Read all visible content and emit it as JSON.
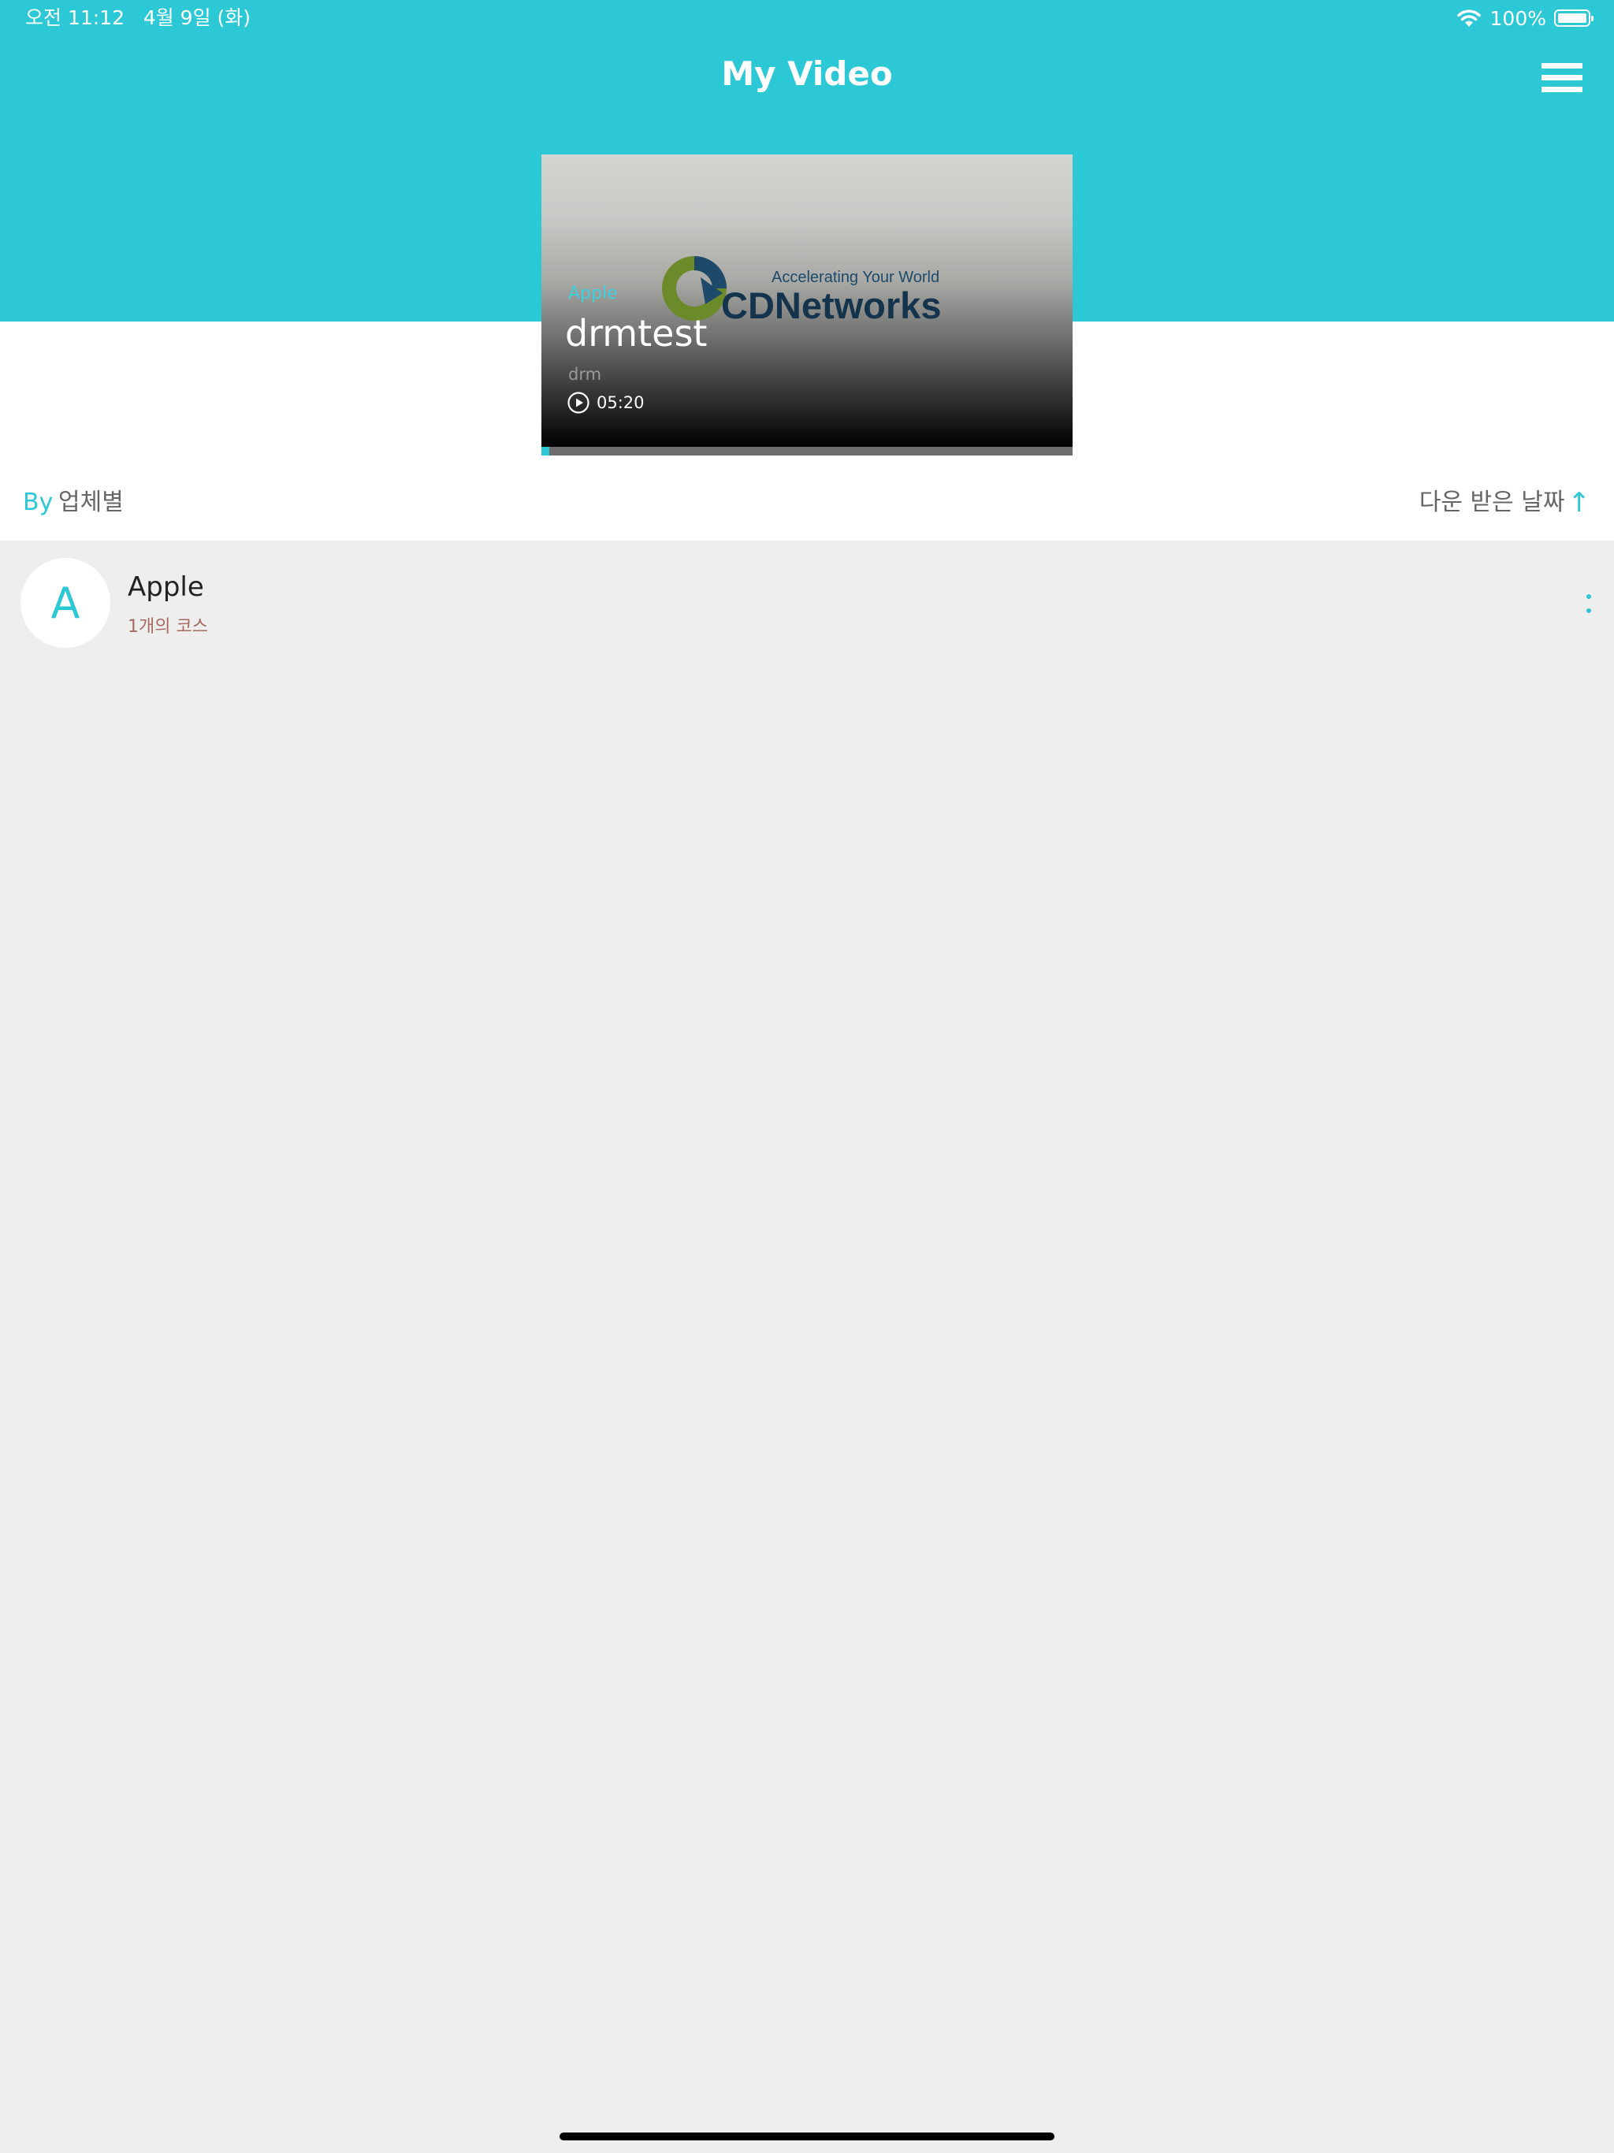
{
  "status_bar": {
    "time": "오전 11:12   4월 9일 (화)",
    "battery": "100%",
    "wifi_icon": "wifi-icon",
    "battery_icon": "battery-icon"
  },
  "header": {
    "title": "My Video",
    "menu_icon": "hamburger-menu-icon",
    "background_color": "#2dc8d6"
  },
  "featured": {
    "provider": "Apple",
    "title": "drmtest",
    "subtitle": "drm",
    "duration": "05:20",
    "progress": 0.015,
    "logo": {
      "tagline": "Accelerating Your World",
      "name": "CDNetworks"
    }
  },
  "filter_bar": {
    "by_label": "By",
    "group_value": "업체별",
    "sort_label": "다운 받은 날짜",
    "sort_icon": "arrow-up-icon"
  },
  "providers": [
    {
      "initial": "A",
      "name": "Apple",
      "count_label": "1개의 코스",
      "more_icon": "more-vertical-icon"
    }
  ],
  "colors": {
    "accent": "#2dc8d6",
    "background": "#eeeeee",
    "course_count": "#a66a62"
  }
}
